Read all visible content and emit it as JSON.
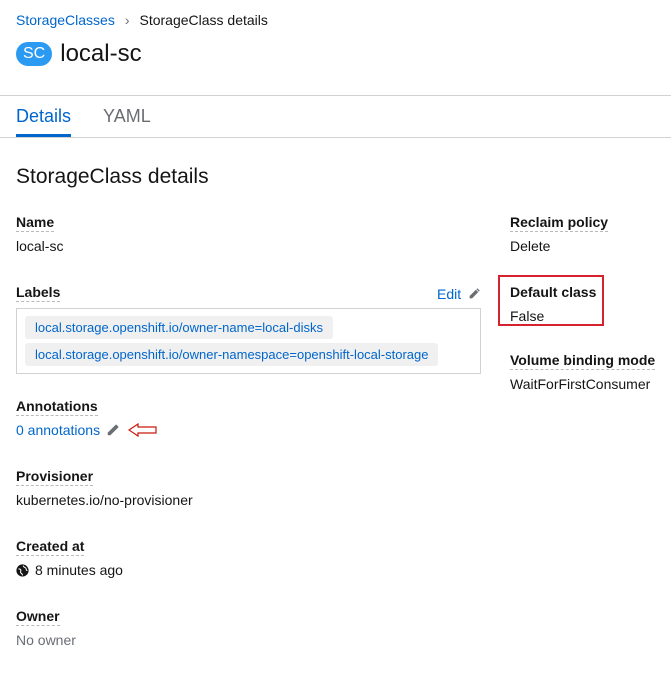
{
  "breadcrumb": {
    "parent": "StorageClasses",
    "current": "StorageClass details",
    "separator": "›"
  },
  "header": {
    "badge": "SC",
    "title": "local-sc"
  },
  "tabs": [
    {
      "label": "Details",
      "active": true
    },
    {
      "label": "YAML",
      "active": false
    }
  ],
  "section_title": "StorageClass details",
  "details": {
    "name_label": "Name",
    "name_value": "local-sc",
    "labels_label": "Labels",
    "labels_edit": "Edit",
    "labels": [
      "local.storage.openshift.io/owner-name=local-disks",
      "local.storage.openshift.io/owner-namespace=openshift-local-storage"
    ],
    "annotations_label": "Annotations",
    "annotations_value": "0 annotations",
    "provisioner_label": "Provisioner",
    "provisioner_value": "kubernetes.io/no-provisioner",
    "created_label": "Created at",
    "created_value": "8 minutes ago",
    "owner_label": "Owner",
    "owner_value": "No owner"
  },
  "side": {
    "reclaim_label": "Reclaim policy",
    "reclaim_value": "Delete",
    "default_label": "Default class",
    "default_value": "False",
    "binding_label": "Volume binding mode",
    "binding_value": "WaitForFirstConsumer"
  },
  "colors": {
    "link": "#0066cc",
    "badge": "#2b9af3",
    "highlight": "#d6222f"
  }
}
